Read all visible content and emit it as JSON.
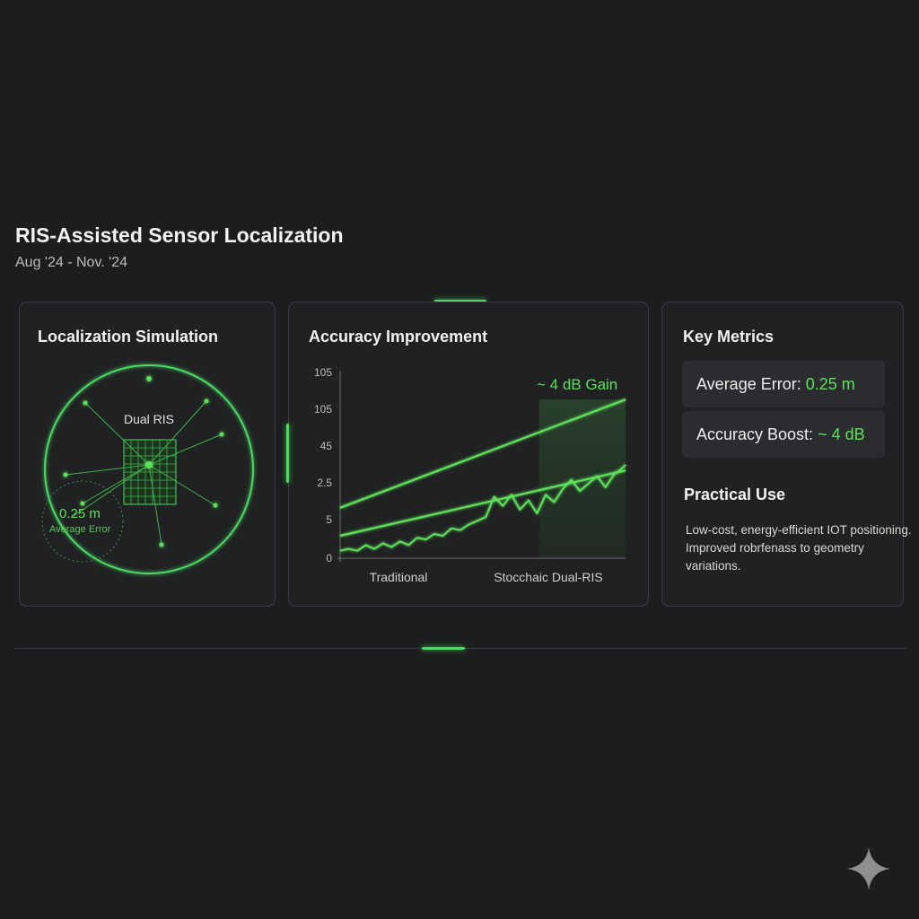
{
  "header": {
    "title": "RIS-Assisted Sensor Localization",
    "subtitle": "Aug '24 - Nov. '24"
  },
  "simulation": {
    "title": "Localization Simulation",
    "ris_label": "Dual RIS",
    "error_value": "0.25 m",
    "error_label": "Average Error"
  },
  "chart_panel": {
    "title": "Accuracy Improvement",
    "gain_label": "~ 4 dB Gain"
  },
  "chart_data": {
    "type": "line",
    "title": "Accuracy Improvement",
    "y_tick_labels": [
      "0",
      "5",
      "2.5",
      "45",
      "105",
      "105"
    ],
    "x_tick_labels": [
      "Traditional",
      "Stocchaic Dual-RIS"
    ],
    "xlabel": "",
    "ylabel": "",
    "grid": false,
    "legend": "none",
    "annotation": "~ 4 dB Gain",
    "series": [
      {
        "x": [
          0,
          1
        ],
        "y": [
          0.27,
          0.85
        ]
      },
      {
        "x": [
          0,
          1
        ],
        "y": [
          0.12,
          0.47
        ]
      },
      {
        "x": [
          0,
          0.03,
          0.06,
          0.09,
          0.12,
          0.15,
          0.18,
          0.21,
          0.24,
          0.27,
          0.3,
          0.33,
          0.36,
          0.39,
          0.42,
          0.45,
          0.48,
          0.51,
          0.54,
          0.57,
          0.6,
          0.63,
          0.66,
          0.69,
          0.72,
          0.75,
          0.78,
          0.81,
          0.84,
          0.87,
          0.9,
          0.93,
          0.96,
          0.98,
          1.0
        ],
        "y": [
          0.04,
          0.05,
          0.04,
          0.07,
          0.05,
          0.08,
          0.06,
          0.09,
          0.07,
          0.11,
          0.1,
          0.13,
          0.12,
          0.16,
          0.15,
          0.18,
          0.2,
          0.22,
          0.33,
          0.28,
          0.34,
          0.26,
          0.31,
          0.24,
          0.34,
          0.3,
          0.37,
          0.42,
          0.36,
          0.4,
          0.44,
          0.38,
          0.45,
          0.47,
          0.5
        ]
      }
    ],
    "highlight_x_range": [
      0.7,
      1.0
    ]
  },
  "metrics": {
    "title": "Key Metrics",
    "items": [
      {
        "label": "Average Error: ",
        "value": "0.25 m"
      },
      {
        "label": "Accuracy Boost: ",
        "value": "~ 4 dB"
      }
    ]
  },
  "practical": {
    "title": "Practical Use",
    "lines": [
      "Low-cost, energy-efficient IOT positioning.",
      "Improved robrfenass to geometry",
      "variations."
    ]
  },
  "colors": {
    "accent": "#4cd964",
    "background": "#1c1d1f",
    "card": "#202123"
  },
  "icons": [
    "sparkle-icon"
  ]
}
